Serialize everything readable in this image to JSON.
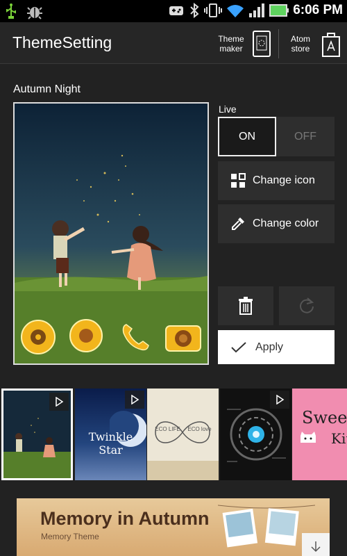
{
  "status_bar": {
    "time": "6:06 PM"
  },
  "header": {
    "title": "ThemeSetting",
    "theme_maker_label": "Theme maker",
    "atom_store_label": "Atom store"
  },
  "theme": {
    "name": "Autumn Night",
    "live_label": "Live",
    "on_label": "ON",
    "off_label": "OFF",
    "live_state": "ON"
  },
  "actions": {
    "change_icon_label": "Change icon",
    "change_color_label": "Change color",
    "apply_label": "Apply"
  },
  "thumbnails": [
    {
      "id": "autumn-night",
      "selected": true,
      "text": ""
    },
    {
      "id": "twinkle-star",
      "selected": false,
      "text": "Twinkle Star"
    },
    {
      "id": "eco-life",
      "selected": false,
      "text_left": "ECO LIFE",
      "text_right": "ECO love"
    },
    {
      "id": "tech",
      "selected": false,
      "text": ""
    },
    {
      "id": "sweet-kitty",
      "selected": false,
      "text_1": "Sweet",
      "text_2": "Kit"
    }
  ],
  "banner": {
    "title": "Memory in Autumn",
    "subtitle": "Memory Theme"
  },
  "colors": {
    "background": "#222222",
    "header": "#262626",
    "accent_yellow": "#f2b51c"
  }
}
